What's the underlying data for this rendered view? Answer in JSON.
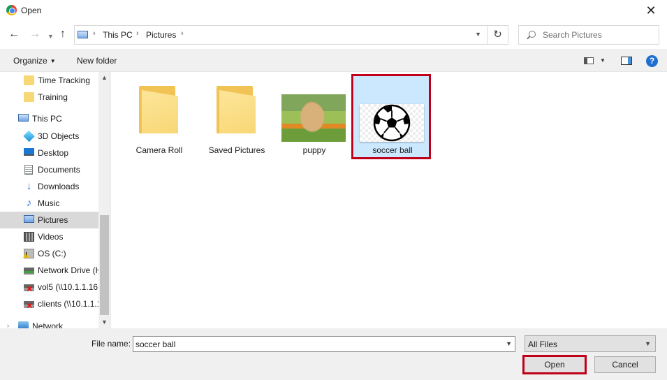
{
  "window": {
    "title": "Open",
    "close_icon": "close-icon",
    "app_icon": "chrome-icon"
  },
  "address": {
    "breadcrumbs": [
      "This PC",
      "Pictures"
    ],
    "search_placeholder": "Search Pictures"
  },
  "toolbar": {
    "organize_label": "Organize",
    "new_folder_label": "New folder"
  },
  "nav": {
    "items": [
      {
        "label": "Time Tracking",
        "icon": "folder-icon"
      },
      {
        "label": "Training",
        "icon": "folder-icon"
      },
      {
        "label": "This PC",
        "icon": "computer-icon"
      },
      {
        "label": "3D Objects",
        "icon": "3d-objects-icon"
      },
      {
        "label": "Desktop",
        "icon": "desktop-icon"
      },
      {
        "label": "Documents",
        "icon": "documents-icon"
      },
      {
        "label": "Downloads",
        "icon": "downloads-icon"
      },
      {
        "label": "Music",
        "icon": "music-icon"
      },
      {
        "label": "Pictures",
        "icon": "pictures-icon",
        "selected": true
      },
      {
        "label": "Videos",
        "icon": "videos-icon"
      },
      {
        "label": "OS (C:)",
        "icon": "drive-warning-icon"
      },
      {
        "label": "Network Drive (H",
        "icon": "network-drive-icon"
      },
      {
        "label": "vol5 (\\\\10.1.1.16",
        "icon": "disconnected-drive-icon"
      },
      {
        "label": "clients (\\\\10.1.1.1",
        "icon": "disconnected-drive-icon"
      },
      {
        "label": "Network",
        "icon": "network-icon"
      }
    ]
  },
  "files": [
    {
      "name": "Camera Roll",
      "type": "folder"
    },
    {
      "name": "Saved Pictures",
      "type": "folder"
    },
    {
      "name": "puppy",
      "type": "image"
    },
    {
      "name": "soccer ball",
      "type": "image",
      "selected": true
    }
  ],
  "footer": {
    "file_name_label": "File name:",
    "file_name_value": "soccer ball",
    "file_type_value": "All Files",
    "open_label": "Open",
    "cancel_label": "Cancel"
  },
  "colors": {
    "selection_bg": "#cce8ff",
    "highlight_border": "#c00018",
    "accent": "#0078d7"
  }
}
